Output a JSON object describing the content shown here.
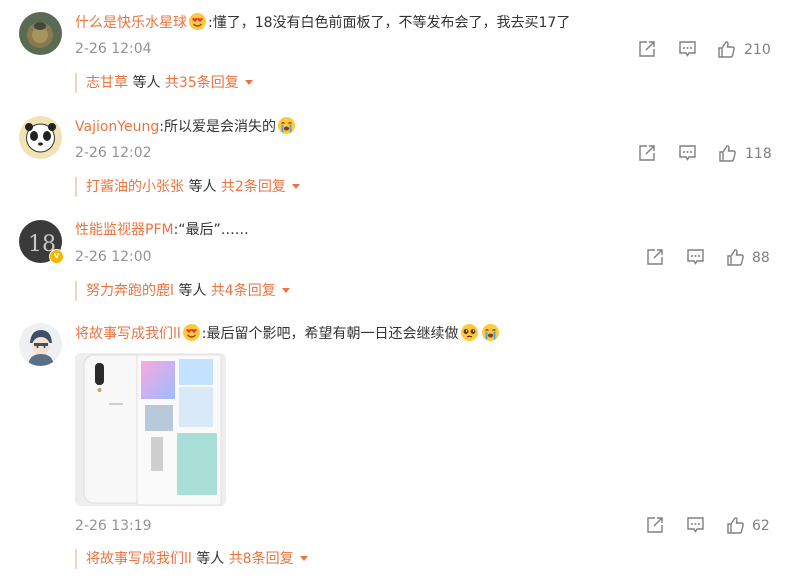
{
  "comments": [
    {
      "username": "什么是快乐水星球",
      "emoji_after_name": "heart-eyes-emoji",
      "text": ":懂了，18没有白色前面板了，不等发布会了，我去买17了",
      "time": "2-26 12:04",
      "likes": "210",
      "reply_user": "志甘草",
      "reply_mid": "等人",
      "reply_count": "共35条回复"
    },
    {
      "username": "VajionYeung",
      "text": ":所以爱是会消失的",
      "emoji_after_text": "crying-emoji",
      "time": "2-26 12:02",
      "likes": "118",
      "reply_user": "打酱油的小张张",
      "reply_mid": "等人",
      "reply_count": "共2条回复"
    },
    {
      "username": "性能监视器PFM",
      "verified": true,
      "text": ":“最后”……",
      "time": "2-26 12:00",
      "likes": "88",
      "reply_user": "努力奔跑的鹿l",
      "reply_mid": "等人",
      "reply_count": "共4条回复"
    },
    {
      "username": "将故事写成我们ll",
      "emoji_after_name": "heart-eyes-emoji",
      "text": ":最后留个影吧，希望有朝一日还会继续做",
      "emojis_after_text": [
        "pleading-emoji",
        "crying-emoji"
      ],
      "image": "white-phone-photo",
      "time": "2-26 13:19",
      "likes": "62",
      "reply_user": "将故事写成我们ll",
      "reply_mid": "等人",
      "reply_count": "共8条回复"
    }
  ],
  "colors": {
    "username": "#eb7340",
    "text": "#333333",
    "meta": "#939393",
    "icon": "#808080"
  }
}
